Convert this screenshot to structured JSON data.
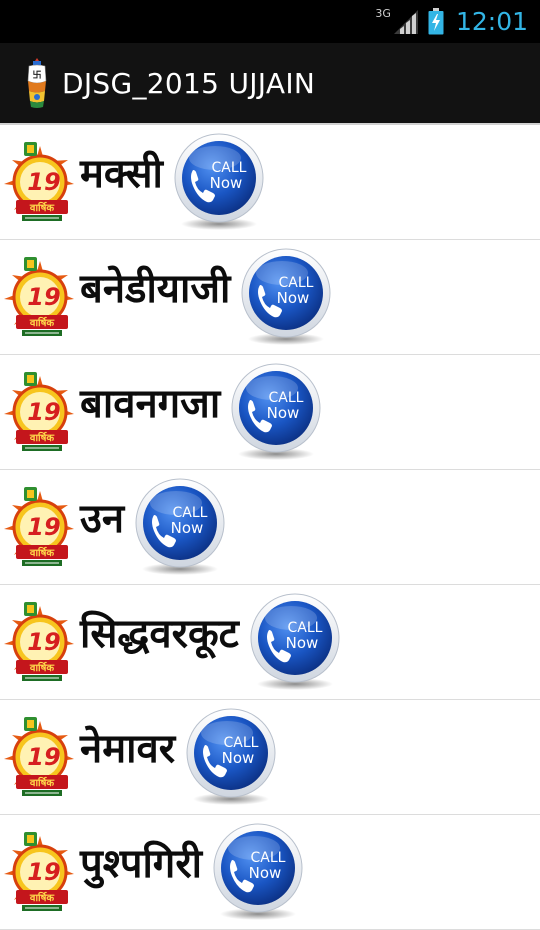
{
  "status_bar": {
    "network": "3G",
    "time": "12:01",
    "signal_icon": "signal-bars-icon",
    "battery_icon": "battery-charging-icon"
  },
  "action_bar": {
    "title": "DJSG_2015 UJJAIN",
    "logo_icon": "app-logo-icon"
  },
  "list": {
    "items": [
      {
        "name": "मक्सी",
        "call_label": [
          "CALL",
          "Now"
        ]
      },
      {
        "name": "बनेडीयाजी",
        "call_label": [
          "CALL",
          "Now"
        ]
      },
      {
        "name": "बावनगजा",
        "call_label": [
          "CALL",
          "Now"
        ]
      },
      {
        "name": "उन",
        "call_label": [
          "CALL",
          "Now"
        ]
      },
      {
        "name": "सिद्धवरकूट",
        "call_label": [
          "CALL",
          "Now"
        ]
      },
      {
        "name": "नेमावर",
        "call_label": [
          "CALL",
          "Now"
        ]
      },
      {
        "name": "पुश्पगिरी",
        "call_label": [
          "CALL",
          "Now"
        ]
      }
    ],
    "badge_text": "19",
    "badge_sub": "वार्षिक"
  },
  "colors": {
    "status_bar_bg": "#000000",
    "action_bar_bg": "#121212",
    "clock": "#33b5e5",
    "call_button_blue": "#1a56c4",
    "divider": "#dcdcdc"
  }
}
